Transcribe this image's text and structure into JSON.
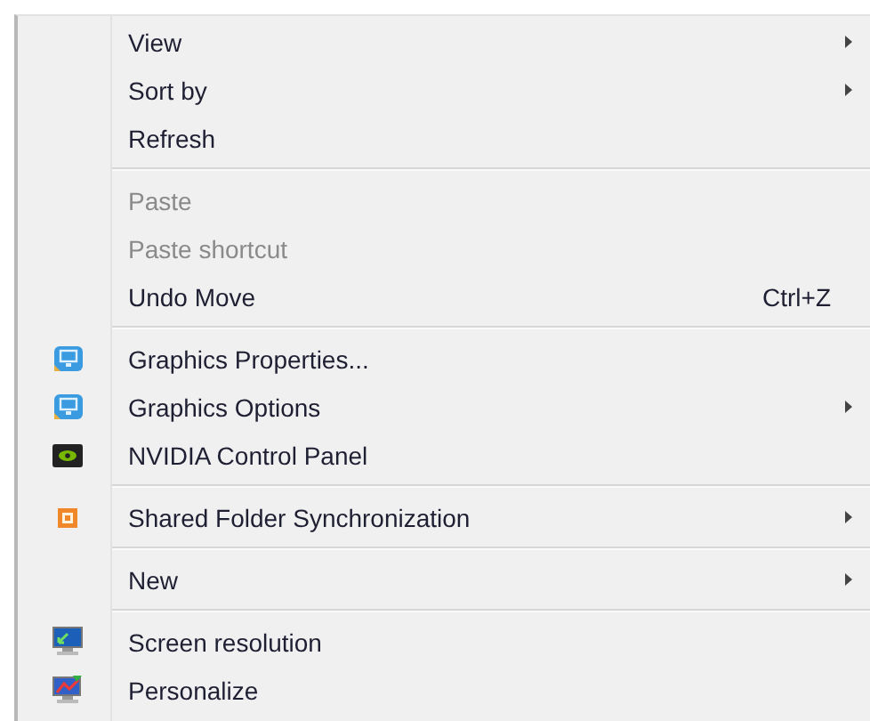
{
  "menu": {
    "groups": [
      {
        "items": [
          {
            "label": "View",
            "disabled": false,
            "submenu": true
          },
          {
            "label": "Sort by",
            "disabled": false,
            "submenu": true
          },
          {
            "label": "Refresh",
            "disabled": false,
            "submenu": false
          }
        ]
      },
      {
        "items": [
          {
            "label": "Paste",
            "disabled": true,
            "submenu": false
          },
          {
            "label": "Paste shortcut",
            "disabled": true,
            "submenu": false
          },
          {
            "label": "Undo Move",
            "disabled": false,
            "submenu": false,
            "shortcut": "Ctrl+Z"
          }
        ]
      },
      {
        "items": [
          {
            "label": "Graphics Properties...",
            "disabled": false,
            "submenu": false,
            "kind": "monitor-tile"
          },
          {
            "label": "Graphics Options",
            "disabled": false,
            "submenu": true,
            "kind": "monitor-tile"
          },
          {
            "label": "NVIDIA Control Panel",
            "disabled": false,
            "submenu": false,
            "kind": "dark-tile"
          }
        ]
      },
      {
        "items": [
          {
            "label": "Shared Folder Synchronization",
            "disabled": false,
            "submenu": true,
            "kind": "sync"
          }
        ]
      },
      {
        "items": [
          {
            "label": "New",
            "disabled": false,
            "submenu": true
          }
        ]
      },
      {
        "items": [
          {
            "label": "Screen resolution",
            "disabled": false,
            "submenu": false,
            "kind": "display"
          },
          {
            "label": "Personalize",
            "disabled": false,
            "submenu": false,
            "kind": "personalize"
          }
        ]
      }
    ]
  }
}
